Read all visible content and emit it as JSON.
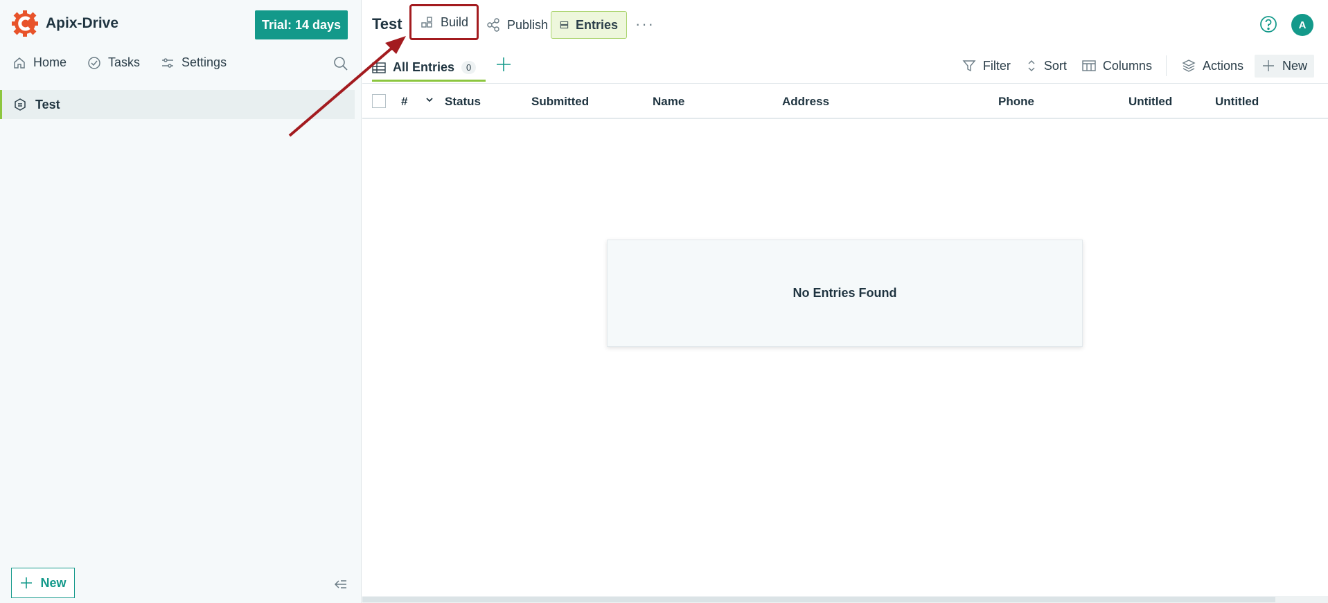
{
  "brand": {
    "name": "Apix-Drive",
    "trial": "Trial: 14 days"
  },
  "sidebar": {
    "nav": [
      {
        "label": "Home",
        "icon": "home-icon"
      },
      {
        "label": "Tasks",
        "icon": "check-circle-icon"
      },
      {
        "label": "Settings",
        "icon": "sliders-icon"
      }
    ],
    "forms": [
      {
        "label": "Test"
      }
    ],
    "new_label": "New"
  },
  "header": {
    "title": "Test",
    "tabs": [
      {
        "label": "Build"
      },
      {
        "label": "Publish"
      },
      {
        "label": "Entries"
      }
    ],
    "more": "···",
    "avatar": "A"
  },
  "toolbar": {
    "view_label": "All Entries",
    "view_count": "0",
    "filter": "Filter",
    "sort": "Sort",
    "columns": "Columns",
    "actions": "Actions",
    "new": "New"
  },
  "table": {
    "columns": [
      "#",
      "Status",
      "Submitted",
      "Name",
      "Address",
      "Phone",
      "Untitled",
      "Untitled"
    ],
    "empty_message": "No Entries Found"
  },
  "colors": {
    "accent": "#13998a",
    "highlight": "#a31b1f",
    "active": "#8cc63f"
  }
}
